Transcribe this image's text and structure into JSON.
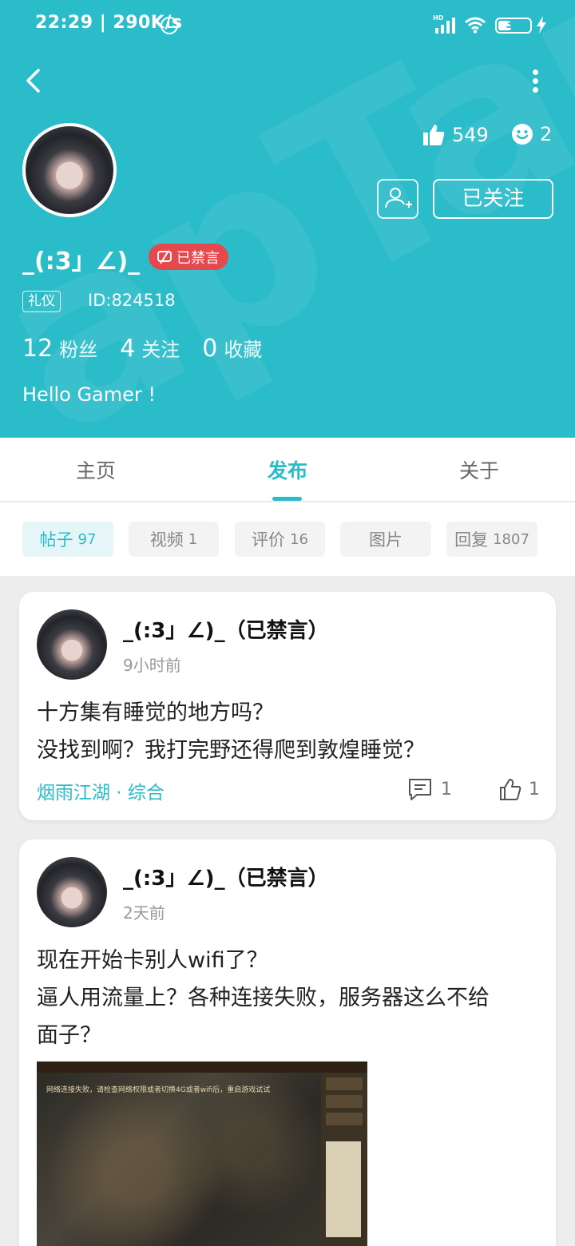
{
  "status_bar": {
    "time": "22:29 | 290K/s",
    "network": "HD",
    "battery": "38"
  },
  "profile": {
    "likes": "549",
    "smiles": "2",
    "follow_label": "已关注",
    "username": "_(:3」∠)_",
    "banned_label": "已禁言",
    "tag": "礼仪",
    "user_id": "ID:824518",
    "fans_count": "12",
    "fans_label": "粉丝",
    "following_count": "4",
    "following_label": "关注",
    "favorites_count": "0",
    "favorites_label": "收藏",
    "bio": "Hello Gamer !"
  },
  "tabs": [
    {
      "label": "主页"
    },
    {
      "label": "发布"
    },
    {
      "label": "关于"
    }
  ],
  "chips": [
    {
      "label": "帖子",
      "count": "97"
    },
    {
      "label": "视频",
      "count": "1"
    },
    {
      "label": "评价",
      "count": "16"
    },
    {
      "label": "图片",
      "count": ""
    },
    {
      "label": "回复",
      "count": "1807"
    }
  ],
  "posts": [
    {
      "author": "_(:3」∠)_（已禁言）",
      "time": "9小时前",
      "line1": "十方集有睡觉的地方吗？",
      "line2": "没找到啊？我打完野还得爬到敦煌睡觉？",
      "forum": "烟雨江湖 · 综合",
      "comments": "1",
      "likes": "1"
    },
    {
      "author": "_(:3」∠)_（已禁言）",
      "time": "2天前",
      "line1": "现在开始卡别人wifi了？",
      "line2": "逼人用流量上？各种连接失败，服务器这么不给",
      "line3": "面子？",
      "image_notice": "网络连接失败，请检查网络权限或者切换4G或者wifi后，重启游戏试试"
    }
  ],
  "icons": {
    "back": "back-arrow-icon",
    "more": "more-vertical-icon",
    "like": "thumbs-up-icon",
    "smile": "smile-icon",
    "add_friend": "add-user-icon",
    "comment": "comment-icon"
  },
  "colors": {
    "accent": "#2bbcc9",
    "banned": "#e5484d",
    "background": "#ededed"
  }
}
